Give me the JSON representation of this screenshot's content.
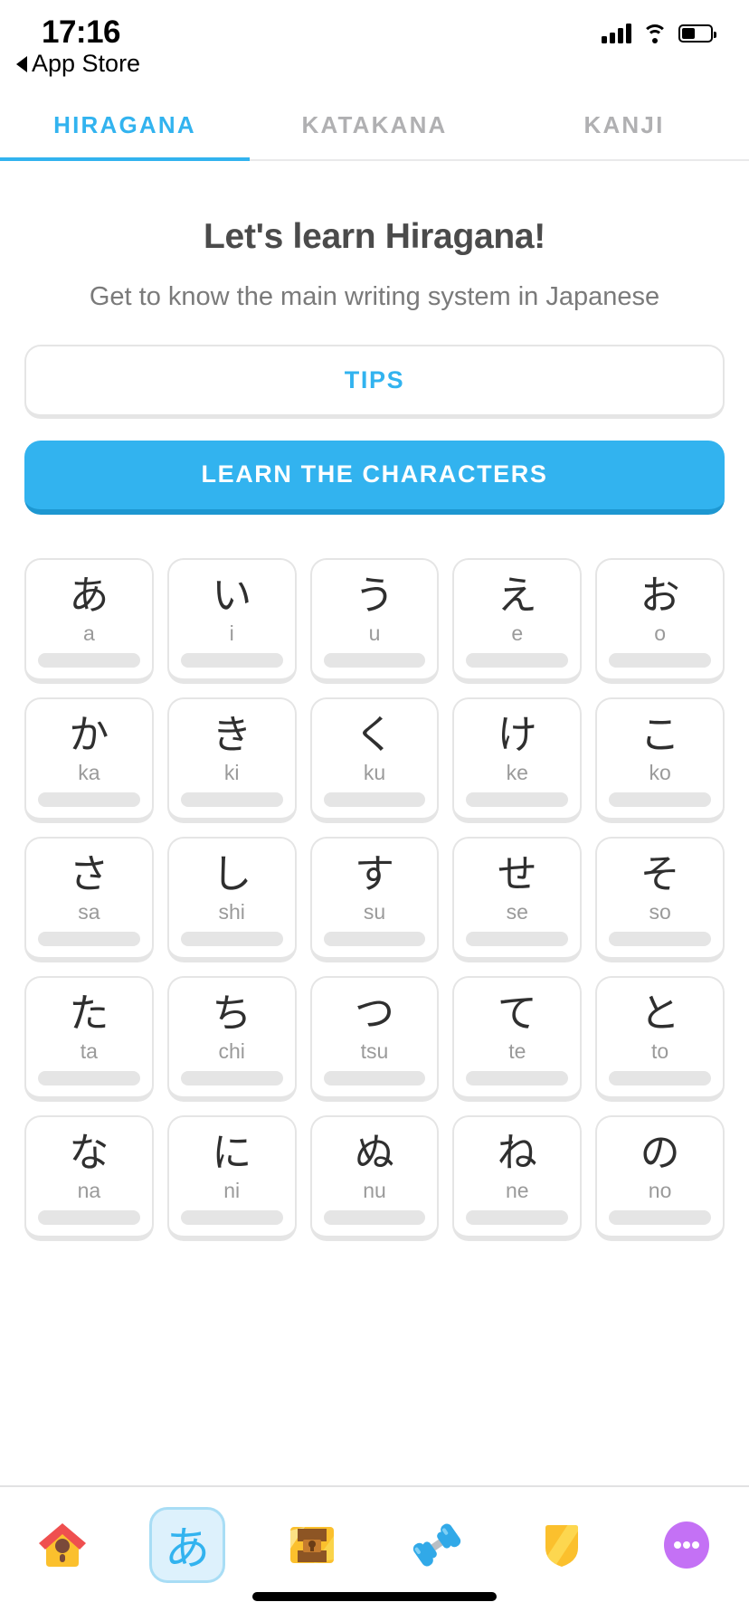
{
  "statusbar": {
    "time": "17:16",
    "back_label": "App Store",
    "signal_icon": "cellular-signal-icon",
    "wifi_icon": "wifi-icon",
    "battery_icon": "battery-icon",
    "battery_level_pct": 40
  },
  "tabs": [
    {
      "label": "HIRAGANA",
      "active": true
    },
    {
      "label": "KATAKANA",
      "active": false
    },
    {
      "label": "KANJI",
      "active": false
    }
  ],
  "main": {
    "headline": "Let's learn Hiragana!",
    "subhead": "Get to know the main writing system in Japanese",
    "tips_button": "TIPS",
    "learn_button": "LEARN THE CHARACTERS"
  },
  "colors": {
    "accent_blue": "#32b3ef",
    "accent_blue_dark": "#1d97d1",
    "text_dark": "#4b4b4b",
    "text_muted": "#7a7a7a",
    "romaji_gray": "#9a9a9a",
    "card_border": "#e5e5e5",
    "progress_track": "#e5e5e5",
    "tab_inactive": "#b0b0b2",
    "tab_selected_bg": "#ddf1fc"
  },
  "characters": [
    {
      "kana": "あ",
      "romaji": "a",
      "progress": 0
    },
    {
      "kana": "い",
      "romaji": "i",
      "progress": 0
    },
    {
      "kana": "う",
      "romaji": "u",
      "progress": 0
    },
    {
      "kana": "え",
      "romaji": "e",
      "progress": 0
    },
    {
      "kana": "お",
      "romaji": "o",
      "progress": 0
    },
    {
      "kana": "か",
      "romaji": "ka",
      "progress": 0
    },
    {
      "kana": "き",
      "romaji": "ki",
      "progress": 0
    },
    {
      "kana": "く",
      "romaji": "ku",
      "progress": 0
    },
    {
      "kana": "け",
      "romaji": "ke",
      "progress": 0
    },
    {
      "kana": "こ",
      "romaji": "ko",
      "progress": 0
    },
    {
      "kana": "さ",
      "romaji": "sa",
      "progress": 0
    },
    {
      "kana": "し",
      "romaji": "shi",
      "progress": 0
    },
    {
      "kana": "す",
      "romaji": "su",
      "progress": 0
    },
    {
      "kana": "せ",
      "romaji": "se",
      "progress": 0
    },
    {
      "kana": "そ",
      "romaji": "so",
      "progress": 0
    },
    {
      "kana": "た",
      "romaji": "ta",
      "progress": 0
    },
    {
      "kana": "ち",
      "romaji": "chi",
      "progress": 0
    },
    {
      "kana": "つ",
      "romaji": "tsu",
      "progress": 0
    },
    {
      "kana": "て",
      "romaji": "te",
      "progress": 0
    },
    {
      "kana": "と",
      "romaji": "to",
      "progress": 0
    },
    {
      "kana": "な",
      "romaji": "na",
      "progress": 0
    },
    {
      "kana": "に",
      "romaji": "ni",
      "progress": 0
    },
    {
      "kana": "ぬ",
      "romaji": "nu",
      "progress": 0
    },
    {
      "kana": "ね",
      "romaji": "ne",
      "progress": 0
    },
    {
      "kana": "の",
      "romaji": "no",
      "progress": 0
    }
  ],
  "tabbar": [
    {
      "icon": "birdhouse-home-icon",
      "selected": false
    },
    {
      "icon": "hiragana-a-icon",
      "selected": true,
      "glyph": "あ"
    },
    {
      "icon": "treasure-chest-icon",
      "selected": false
    },
    {
      "icon": "dumbbell-icon",
      "selected": false
    },
    {
      "icon": "shield-icon",
      "selected": false
    },
    {
      "icon": "more-ellipsis-icon",
      "selected": false
    }
  ]
}
